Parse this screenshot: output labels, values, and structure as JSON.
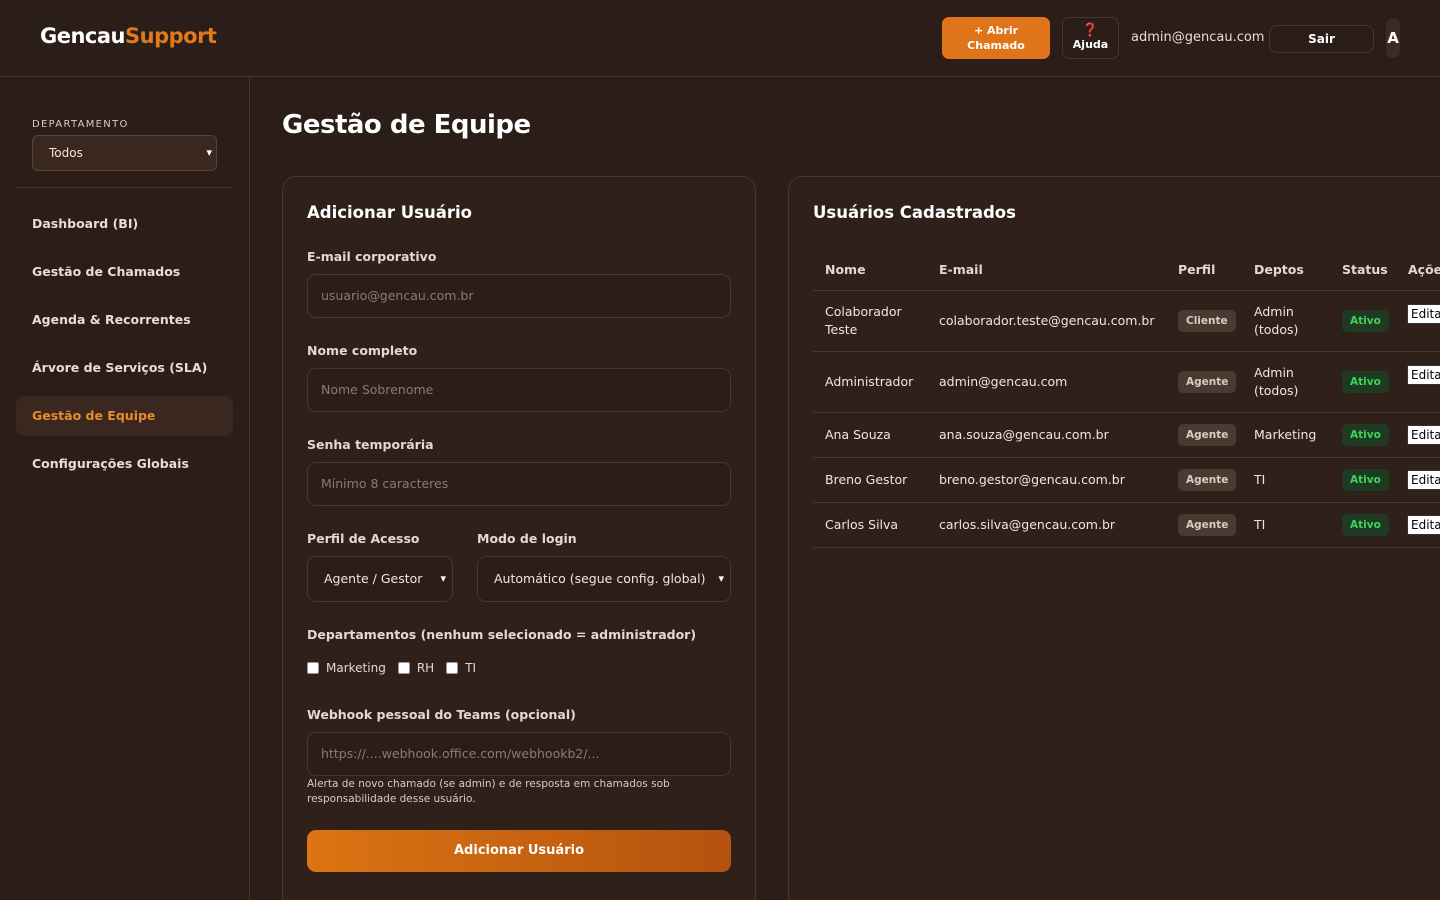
{
  "header": {
    "logo_part1": "Gencau",
    "logo_part2": "Support",
    "open_ticket_line1": "+ Abrir",
    "open_ticket_line2": "Chamado",
    "help_icon": "❓",
    "help_label": "Ajuda",
    "user_email": "admin@gencau.com",
    "logout_label": "Sair",
    "avatar_initial": "A"
  },
  "sidebar": {
    "department_label": "DEPARTAMENTO",
    "department_value": "Todos",
    "items": [
      {
        "label": "Dashboard (BI)"
      },
      {
        "label": "Gestão de Chamados"
      },
      {
        "label": "Agenda & Recorrentes"
      },
      {
        "label": "Árvore de Serviços (SLA)"
      },
      {
        "label": "Gestão de Equipe"
      },
      {
        "label": "Configurações Globais"
      }
    ]
  },
  "main": {
    "page_title": "Gestão de Equipe",
    "form": {
      "title": "Adicionar Usuário",
      "email_label": "E-mail corporativo",
      "email_placeholder": "usuario@gencau.com.br",
      "name_label": "Nome completo",
      "name_placeholder": "Nome Sobrenome",
      "password_label": "Senha temporária",
      "password_placeholder": "Mínimo 8 caracteres",
      "profile_label": "Perfil de Acesso",
      "profile_value": "Agente / Gestor",
      "login_mode_label": "Modo de login",
      "login_mode_value": "Automático (segue config. global)",
      "departments_label": "Departamentos (nenhum selecionado = administrador)",
      "departments": [
        "Marketing",
        "RH",
        "TI"
      ],
      "webhook_label": "Webhook pessoal do Teams (opcional)",
      "webhook_placeholder": "https://....webhook.office.com/webhookb2/...",
      "webhook_hint": "Alerta de novo chamado (se admin) e de resposta em chamados sob responsabilidade desse usuário.",
      "submit_label": "Adicionar Usuário"
    },
    "users": {
      "title": "Usuários Cadastrados",
      "columns": [
        "Nome",
        "E-mail",
        "Perfil",
        "Deptos",
        "Status",
        "Ações"
      ],
      "rows": [
        {
          "name": "Colaborador Teste",
          "email": "colaborador.teste@gencau.com.br",
          "role": "Cliente",
          "depts": "Admin (todos)",
          "status": "Ativo",
          "action": "Editar"
        },
        {
          "name": "Administrador",
          "email": "admin@gencau.com",
          "role": "Agente",
          "depts": "Admin (todos)",
          "status": "Ativo",
          "action": "Editar"
        },
        {
          "name": "Ana Souza",
          "email": "ana.souza@gencau.com.br",
          "role": "Agente",
          "depts": "Marketing",
          "status": "Ativo",
          "action": "Editar"
        },
        {
          "name": "Breno Gestor",
          "email": "breno.gestor@gencau.com.br",
          "role": "Agente",
          "depts": "TI",
          "status": "Ativo",
          "action": "Editar"
        },
        {
          "name": "Carlos Silva",
          "email": "carlos.silva@gencau.com.br",
          "role": "Agente",
          "depts": "TI",
          "status": "Ativo",
          "action": "Editar"
        }
      ]
    }
  },
  "colors": {
    "background": "#2b1d17",
    "accent": "#e0741a",
    "active_status": "#3fd35b"
  }
}
